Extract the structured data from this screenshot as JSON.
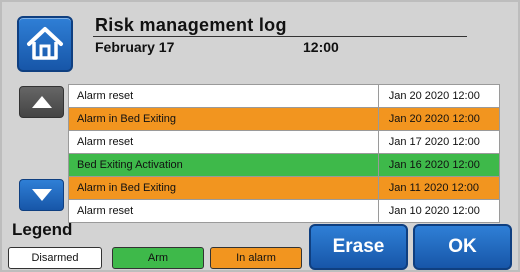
{
  "colors": {
    "accent_blue": "#1f6dc7",
    "alarm_orange": "#f2951f",
    "arm_green": "#3eb94a",
    "background": "#d3d3d3"
  },
  "header": {
    "title": "Risk management log",
    "date": "February 17",
    "time": "12:00",
    "home_icon": "home-icon"
  },
  "scroll": {
    "up_icon": "triangle-up-icon",
    "down_icon": "triangle-down-icon"
  },
  "log": [
    {
      "event": "Alarm reset",
      "timestamp": "Jan 20 2020 12:00",
      "status": "reset"
    },
    {
      "event": "Alarm in Bed Exiting",
      "timestamp": "Jan 20 2020 12:00",
      "status": "alarm"
    },
    {
      "event": "Alarm reset",
      "timestamp": "Jan 17 2020 12:00",
      "status": "reset"
    },
    {
      "event": "Bed Exiting Activation",
      "timestamp": "Jan 16 2020 12:00",
      "status": "arm"
    },
    {
      "event": "Alarm in Bed Exiting",
      "timestamp": "Jan 11 2020 12:00",
      "status": "alarm"
    },
    {
      "event": "Alarm reset",
      "timestamp": "Jan 10 2020 12:00",
      "status": "reset"
    }
  ],
  "legend": {
    "title": "Legend",
    "items": [
      {
        "label": "Disarmed",
        "color": "#ffffff"
      },
      {
        "label": "Arm",
        "color": "#3eb94a"
      },
      {
        "label": "In alarm",
        "color": "#f2951f"
      }
    ]
  },
  "buttons": {
    "erase": "Erase",
    "ok": "OK"
  }
}
